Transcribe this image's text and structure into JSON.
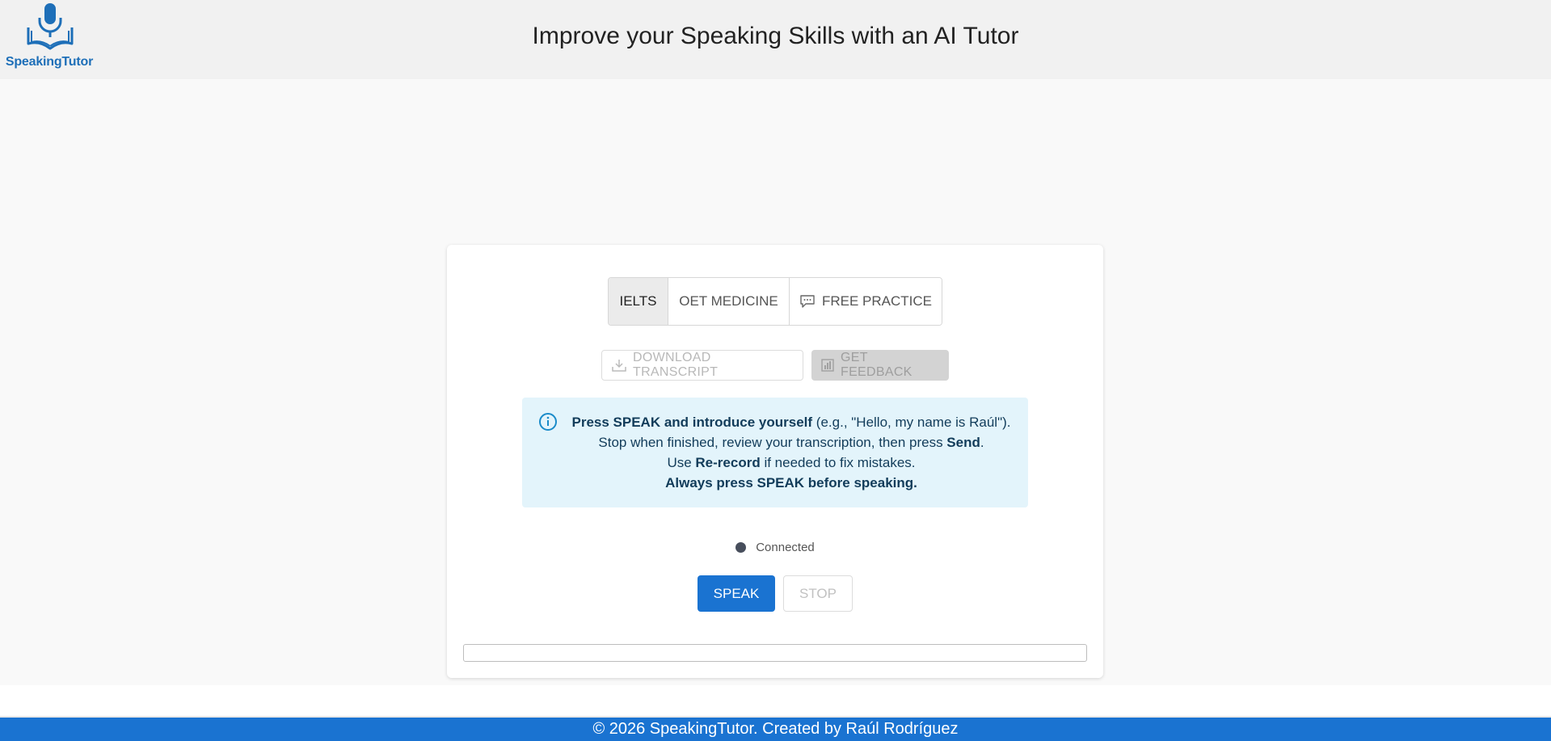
{
  "brand": {
    "name": "SpeakingTutor",
    "logo_icon": "microphone-book-icon",
    "color": "#1e6fb8"
  },
  "header": {
    "title": "Improve your Speaking Skills with an AI Tutor"
  },
  "modes": [
    {
      "label": "IELTS",
      "active": true
    },
    {
      "label": "OET MEDICINE",
      "active": false
    },
    {
      "label": "FREE PRACTICE",
      "active": false,
      "icon": "chat-bubble-icon"
    }
  ],
  "actions": {
    "download_label": "DOWNLOAD TRANSCRIPT",
    "download_icon": "download-icon",
    "feedback_label": "GET FEEDBACK",
    "feedback_icon": "bar-chart-icon"
  },
  "info": {
    "icon": "info-icon",
    "line1_bold": "Press SPEAK and introduce yourself",
    "line1_rest": " (e.g., \"Hello, my name is Raúl\").",
    "line2_pre": "Stop when finished, review your transcription, then press ",
    "line2_bold": "Send",
    "line2_post": ".",
    "line3_pre": "Use ",
    "line3_bold": "Re-record",
    "line3_post": " if needed to fix mistakes.",
    "line4_bold": "Always press SPEAK before speaking."
  },
  "status": {
    "text": "Connected",
    "dot_color": "#474e5c"
  },
  "controls": {
    "speak_label": "SPEAK",
    "stop_label": "STOP"
  },
  "footer": {
    "text": "© 2026 SpeakingTutor. Created by Raúl Rodríguez"
  },
  "colors": {
    "primary": "#1a73d1",
    "info_bg": "#e3f4fb"
  }
}
